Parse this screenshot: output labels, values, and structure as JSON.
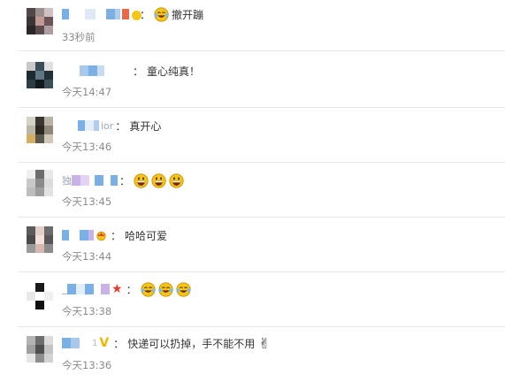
{
  "comments": [
    {
      "id": 1,
      "text": "撤开蹦",
      "time": "33秒前",
      "emojis": [
        "laugh-cry-icon"
      ],
      "badge": "red-square"
    },
    {
      "id": 2,
      "text": "童心纯真！",
      "time": "今天14:47",
      "emojis": [],
      "badge": ""
    },
    {
      "id": 3,
      "name_fragment": "ior",
      "text": "真开心",
      "time": "今天13:46",
      "emojis": [],
      "badge": ""
    },
    {
      "id": 4,
      "name_fragment": "独",
      "text": "",
      "time": "今天13:45",
      "emojis": [
        "grin-icon",
        "grin-icon",
        "grin-icon"
      ],
      "badge": ""
    },
    {
      "id": 5,
      "text": "哈哈可爱",
      "time": "今天13:44",
      "emojis": [],
      "badge": "crown"
    },
    {
      "id": 6,
      "text": "",
      "time": "今天13:38",
      "emojis": [
        "laugh-cry-icon",
        "laugh-cry-icon",
        "laugh-cry-icon"
      ],
      "badge": "star"
    },
    {
      "id": 7,
      "name_fragment": "1",
      "text": "快递可以扔掉，手不能不用",
      "time": "今天13:36",
      "emojis": [],
      "badge": "v",
      "badge_text": "V",
      "trailing_icon": "victory-hand-icon",
      "trailing_glyph": "✌"
    }
  ],
  "colon": "：",
  "colors": {
    "text": "#333333",
    "time": "#8c8c8c",
    "divider": "#e8e8e8",
    "mosaic_blue": "#7ab0e6",
    "mosaic_purple": "#c9b3e6",
    "emoji_yellow": "#f5c518"
  }
}
